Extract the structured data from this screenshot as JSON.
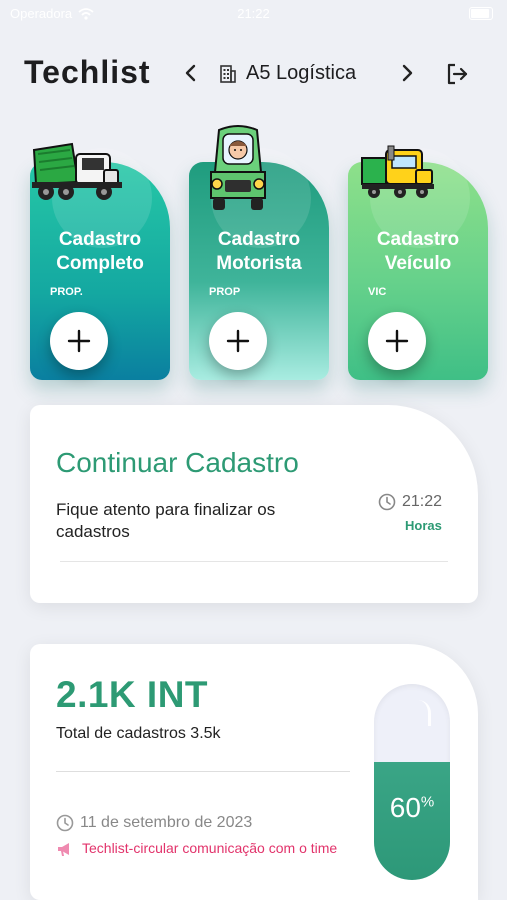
{
  "status_bar": {
    "carrier": "Operadora",
    "time": "21:22"
  },
  "header": {
    "app_title": "Techlist",
    "company": "A5 Logística"
  },
  "actions": [
    {
      "title_line1": "Cadastro",
      "title_line2": "Completo",
      "subtitle": "PROP."
    },
    {
      "title_line1": "Cadastro",
      "title_line2": "Motorista",
      "subtitle": "PROP"
    },
    {
      "title_line1": "Cadastro",
      "title_line2": "Veículo",
      "subtitle": "VIC"
    }
  ],
  "continuar": {
    "heading": "Continuar Cadastro",
    "description": "Fique atento para finalizar os cadastros",
    "time": "21:22",
    "time_label": "Horas"
  },
  "stats": {
    "headline": "2.1K INT",
    "total": "Total de cadastros 3.5k",
    "date": "11 de setembro de 2023",
    "notice": "Techlist-circular comunicação com o time",
    "progress_value": "60",
    "progress_unit": "%",
    "progress_fraction": 0.6
  },
  "colors": {
    "accent": "#2d9a74",
    "notice": "#e2336b",
    "background": "#eef0f5"
  }
}
